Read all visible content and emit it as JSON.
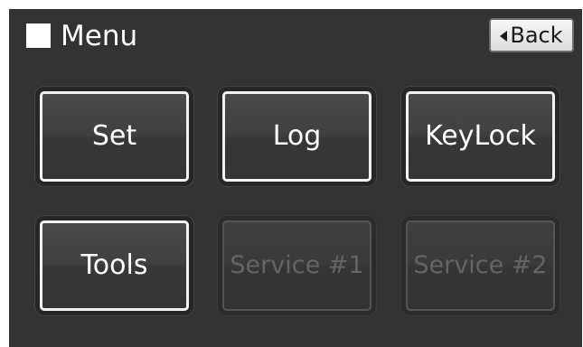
{
  "header": {
    "title": "Menu",
    "back_label": "Back"
  },
  "menu": {
    "set_label": "Set",
    "log_label": "Log",
    "keylock_label": "KeyLock",
    "tools_label": "Tools",
    "service1_label": "Service #1",
    "service2_label": "Service #2"
  },
  "colors": {
    "background": "#333333",
    "enabled_text": "#ffffff",
    "disabled_text": "#656565",
    "back_button": "#e8e8e8"
  },
  "icons": {
    "menu": "filled-square-icon",
    "back": "left-triangle-icon"
  }
}
